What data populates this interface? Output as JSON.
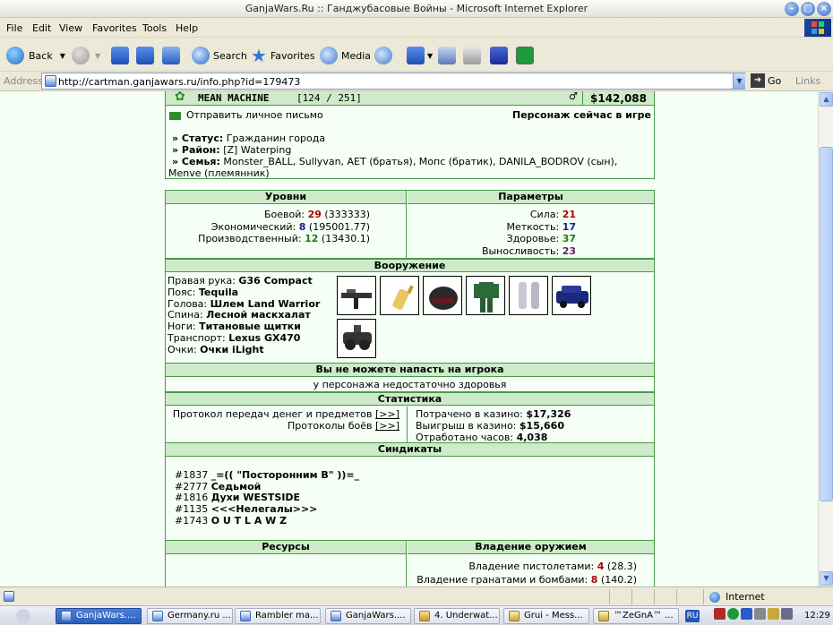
{
  "window": {
    "title": "GanjaWars.Ru :: Ганджубасовые Войны - Microsoft Internet Explorer"
  },
  "menu": [
    "File",
    "Edit",
    "View",
    "Favorites",
    "Tools",
    "Help"
  ],
  "toolbar": {
    "back": "Back",
    "search": "Search",
    "favorites": "Favorites",
    "media": "Media"
  },
  "address": {
    "label": "Address",
    "url": "http://cartman.ganjawars.ru/info.php?id=179473",
    "go": "Go",
    "links": "Links"
  },
  "player": {
    "name": "MEAN MACHINE",
    "level": "[124 / 251]",
    "money": "$142,088",
    "send_message": "Отправить личное письмо",
    "online_status": "Персонаж сейчас в игре",
    "status_label": "» Статус:",
    "status_value": "Гражданин города",
    "district_label": "» Район:",
    "district_value": "[Z] Waterping",
    "family_label": "» Семья:",
    "family_value": "Monster_BALL, Sullyvan, AET (братья), Мопс (братик), DANILA_BODROV (сын),",
    "family_value2": "Menve (племянник)"
  },
  "levels": {
    "header": "Уровни",
    "rows": [
      {
        "label": "Боевой:",
        "value": "29",
        "extra": "(333333)"
      },
      {
        "label": "Экономический:",
        "value": "8",
        "extra": "(195001.77)"
      },
      {
        "label": "Производственный:",
        "value": "12",
        "extra": "(13430.1)"
      }
    ]
  },
  "params": {
    "header": "Параметры",
    "rows": [
      {
        "label": "Сила:",
        "value": "21"
      },
      {
        "label": "Меткость:",
        "value": "17"
      },
      {
        "label": "Здоровье:",
        "value": "37"
      },
      {
        "label": "Выносливость:",
        "value": "23"
      }
    ]
  },
  "weapons": {
    "header": "Вооружение",
    "rows": [
      {
        "label": "Правая рука:",
        "value": "G36 Compact"
      },
      {
        "label": "Пояс:",
        "value": "Tequila"
      },
      {
        "label": "Голова:",
        "value": "Шлем Land Warrior"
      },
      {
        "label": "Спина:",
        "value": "Лесной маскхалат"
      },
      {
        "label": "Ноги:",
        "value": "Титановые щитки"
      },
      {
        "label": "Транспорт:",
        "value": "Lexus GX470"
      },
      {
        "label": "Очки:",
        "value": "Очки iLight"
      }
    ]
  },
  "attack": {
    "header": "Вы не можете напасть на игрока",
    "reason": "у персонажа недостаточно здоровья"
  },
  "stats": {
    "header": "Статистика",
    "transfer_protocol": "Протокол передач денег и предметов",
    "battle_protocol": "Протоколы боёв",
    "link": "[>>]",
    "casino_spent_label": "Потрачено в казино:",
    "casino_spent": "$17,326",
    "casino_won_label": "Выигрыш в казино:",
    "casino_won": "$15,660",
    "hours_label": "Отработано часов:",
    "hours": "4,038"
  },
  "syndicates": {
    "header": "Синдикаты",
    "items": [
      {
        "id": "#1837",
        "name": "_=(( \"Посторонним В\" ))=_"
      },
      {
        "id": "#2777",
        "name": "Седьмой"
      },
      {
        "id": "#1816",
        "name": "Духи WESTSIDE"
      },
      {
        "id": "#1135",
        "name": "<<<Нелегалы>>>"
      },
      {
        "id": "#1743",
        "name": "O U T L A W Z"
      }
    ]
  },
  "resources": {
    "header": "Ресурсы"
  },
  "mastery": {
    "header": "Владение оружием",
    "rows": [
      {
        "label": "Владение пистолетами:",
        "value": "4",
        "extra": "(28.3)"
      },
      {
        "label": "Владение гранатами и бомбами:",
        "value": "8",
        "extra": "(140.2)"
      }
    ]
  },
  "statusbar": {
    "zone": "Internet"
  },
  "taskbar": {
    "tasks": [
      "GanjaWars....",
      "Germany.ru ...",
      "Rambler ma...",
      "GanjaWars....",
      "4. Underwat...",
      "Grui - Mess...",
      "™ZeGnA™ ..."
    ],
    "lang": "RU",
    "clock": "12:29"
  }
}
